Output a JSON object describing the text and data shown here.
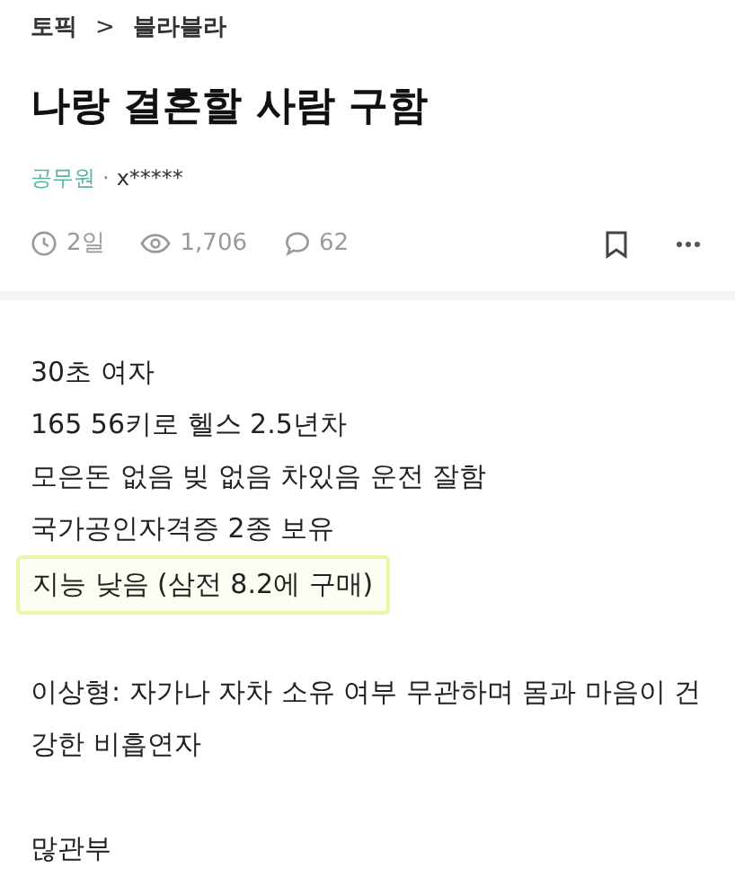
{
  "breadcrumb": {
    "topic": "토픽",
    "separator": ">",
    "board": "블라블라"
  },
  "title": "나랑 결혼할 사람 구함",
  "author": {
    "company": "공무원",
    "separator": "·",
    "name": "x*****"
  },
  "stats": {
    "time": "2일",
    "views": "1,706",
    "comments": "62"
  },
  "paragraphs": [
    {
      "lines": [
        {
          "text": "30초 여자",
          "highlighted": false
        },
        {
          "text": "165 56키로 헬스 2.5년차",
          "highlighted": false
        },
        {
          "text": "모은돈 없음 빚 없음 차있음 운전 잘함",
          "highlighted": false
        },
        {
          "text": "국가공인자격증 2종 보유",
          "highlighted": false
        },
        {
          "text": "지능 낮음 (삼전 8.2에 구매)",
          "highlighted": true
        }
      ]
    },
    {
      "lines": [
        {
          "text": "이상형: 자가나 자차 소유 여부 무관하며 몸과 마음이 건강한 비흡연자",
          "highlighted": false
        }
      ]
    },
    {
      "lines": [
        {
          "text": "많관부",
          "highlighted": false
        }
      ]
    }
  ]
}
